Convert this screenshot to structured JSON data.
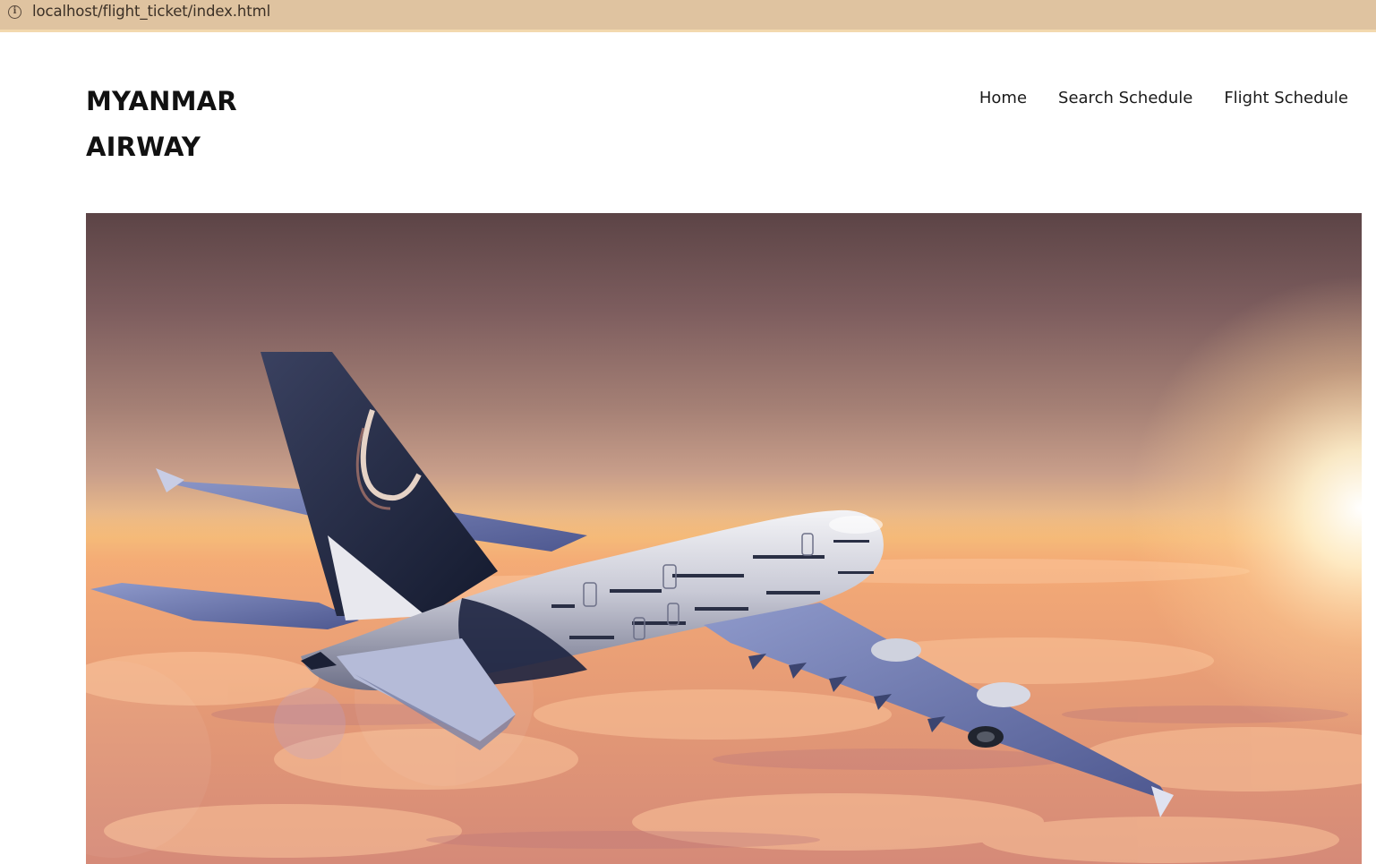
{
  "browser": {
    "url": "localhost/flight_ticket/index.html"
  },
  "brand": {
    "line1": "MYANMAR",
    "line2": "AIRWAY"
  },
  "nav": {
    "items": [
      {
        "label": "Home"
      },
      {
        "label": "Search Schedule"
      },
      {
        "label": "Flight Schedule"
      }
    ]
  },
  "hero": {
    "image": "airplane-above-sunset-clouds"
  },
  "colors": {
    "address_bar": "#dfc3a0",
    "text": "#111111",
    "sky_top": "#5c4446",
    "horizon": "#f5c47a",
    "clouds": "#e6a47f"
  }
}
